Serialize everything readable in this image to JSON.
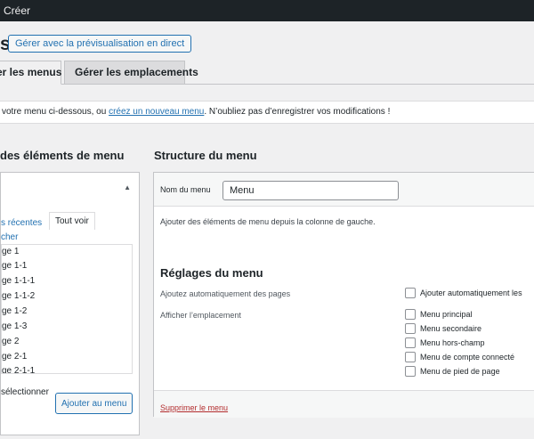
{
  "topbar": {
    "create_label": "Créer"
  },
  "header": {
    "title_fragment": "s",
    "preview_button": "Gérer avec la prévisualisation en direct"
  },
  "tabs": [
    {
      "label": "er les menus"
    },
    {
      "label": "Gérer les emplacements"
    }
  ],
  "notice": {
    "before": "votre menu ci-dessous, ou ",
    "link": "créez un nouveau menu",
    "after": ". N’oubliez pas d’enregistrer vos modifications !"
  },
  "left": {
    "heading": "des éléments de menu",
    "subtabs": {
      "recent": "s récentes",
      "all": "Tout voir",
      "search": "cher"
    },
    "pages": [
      "ge 1",
      "ge 1-1",
      "ge 1-1-1",
      "ge 1-1-2",
      "ge 1-2",
      "ge 1-3",
      "ge 2",
      "ge 2-1",
      "ge 2-1-1"
    ],
    "select_all": "sélectionner",
    "add_button": "Ajouter au menu"
  },
  "right": {
    "heading": "Structure du menu",
    "name_label": "Nom du menu",
    "name_value": "Menu",
    "help_text": "Ajouter des éléments de menu depuis la colonne de gauche.",
    "settings_title": "Réglages du menu",
    "auto_add_label": "Ajoutez automatiquement des pages",
    "auto_add_option": "Ajouter automatiquement les",
    "location_label": "Afficher l’emplacement",
    "locations": [
      "Menu principal",
      "Menu secondaire",
      "Menu hors-champ",
      "Menu de compte connecté",
      "Menu de pied de page"
    ],
    "delete_link": "Supprimer le menu"
  }
}
